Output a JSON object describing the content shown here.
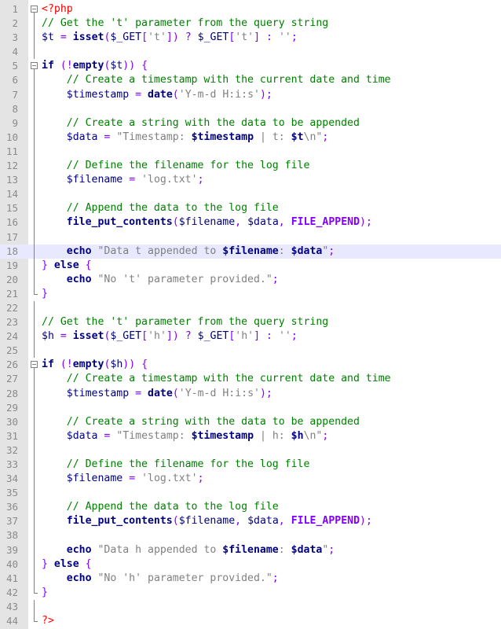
{
  "editor": {
    "current_line": 18,
    "lines": [
      {
        "num": "1",
        "fold": "box",
        "tokens": [
          {
            "t": "<?php",
            "c": "php"
          }
        ]
      },
      {
        "num": "2",
        "fold": "line",
        "tokens": [
          {
            "t": "// Get the 't' parameter from the query string",
            "c": "cm"
          }
        ]
      },
      {
        "num": "3",
        "fold": "line",
        "tokens": [
          {
            "t": "$t",
            "c": "var"
          },
          {
            "t": " ",
            "c": "plain"
          },
          {
            "t": "=",
            "c": "op"
          },
          {
            "t": " ",
            "c": "plain"
          },
          {
            "t": "isset",
            "c": "kw"
          },
          {
            "t": "(",
            "c": "op"
          },
          {
            "t": "$_GET",
            "c": "var"
          },
          {
            "t": "[",
            "c": "op"
          },
          {
            "t": "'t'",
            "c": "str"
          },
          {
            "t": "])",
            "c": "op"
          },
          {
            "t": " ",
            "c": "plain"
          },
          {
            "t": "?",
            "c": "op"
          },
          {
            "t": " ",
            "c": "plain"
          },
          {
            "t": "$_GET",
            "c": "var"
          },
          {
            "t": "[",
            "c": "op"
          },
          {
            "t": "'t'",
            "c": "str"
          },
          {
            "t": "]",
            "c": "op"
          },
          {
            "t": " ",
            "c": "plain"
          },
          {
            "t": ":",
            "c": "op"
          },
          {
            "t": " ",
            "c": "plain"
          },
          {
            "t": "''",
            "c": "str"
          },
          {
            "t": ";",
            "c": "op"
          }
        ]
      },
      {
        "num": "4",
        "fold": "line",
        "tokens": []
      },
      {
        "num": "5",
        "fold": "box",
        "tokens": [
          {
            "t": "if",
            "c": "kw"
          },
          {
            "t": " ",
            "c": "plain"
          },
          {
            "t": "(!",
            "c": "op"
          },
          {
            "t": "empty",
            "c": "kw"
          },
          {
            "t": "(",
            "c": "op"
          },
          {
            "t": "$t",
            "c": "var"
          },
          {
            "t": "))",
            "c": "op"
          },
          {
            "t": " ",
            "c": "plain"
          },
          {
            "t": "{",
            "c": "op"
          }
        ]
      },
      {
        "num": "6",
        "fold": "line",
        "tokens": [
          {
            "t": "    ",
            "c": "plain"
          },
          {
            "t": "// Create a timestamp with the current date and time",
            "c": "cm"
          }
        ]
      },
      {
        "num": "7",
        "fold": "line",
        "tokens": [
          {
            "t": "    ",
            "c": "plain"
          },
          {
            "t": "$timestamp",
            "c": "var"
          },
          {
            "t": " ",
            "c": "plain"
          },
          {
            "t": "=",
            "c": "op"
          },
          {
            "t": " ",
            "c": "plain"
          },
          {
            "t": "date",
            "c": "kw"
          },
          {
            "t": "(",
            "c": "op"
          },
          {
            "t": "'Y-m-d H:i:s'",
            "c": "str"
          },
          {
            "t": ");",
            "c": "op"
          }
        ]
      },
      {
        "num": "8",
        "fold": "line",
        "tokens": []
      },
      {
        "num": "9",
        "fold": "line",
        "tokens": [
          {
            "t": "    ",
            "c": "plain"
          },
          {
            "t": "// Create a string with the data to be appended",
            "c": "cm"
          }
        ]
      },
      {
        "num": "10",
        "fold": "line",
        "tokens": [
          {
            "t": "    ",
            "c": "plain"
          },
          {
            "t": "$data",
            "c": "var"
          },
          {
            "t": " ",
            "c": "plain"
          },
          {
            "t": "=",
            "c": "op"
          },
          {
            "t": " ",
            "c": "plain"
          },
          {
            "t": "\"Timestamp: ",
            "c": "str"
          },
          {
            "t": "$timestamp",
            "c": "kw"
          },
          {
            "t": " | t: ",
            "c": "str"
          },
          {
            "t": "$t",
            "c": "kw"
          },
          {
            "t": "\\n\"",
            "c": "str"
          },
          {
            "t": ";",
            "c": "op"
          }
        ]
      },
      {
        "num": "11",
        "fold": "line",
        "tokens": []
      },
      {
        "num": "12",
        "fold": "line",
        "tokens": [
          {
            "t": "    ",
            "c": "plain"
          },
          {
            "t": "// Define the filename for the log file",
            "c": "cm"
          }
        ]
      },
      {
        "num": "13",
        "fold": "line",
        "tokens": [
          {
            "t": "    ",
            "c": "plain"
          },
          {
            "t": "$filename",
            "c": "var"
          },
          {
            "t": " ",
            "c": "plain"
          },
          {
            "t": "=",
            "c": "op"
          },
          {
            "t": " ",
            "c": "plain"
          },
          {
            "t": "'log.txt'",
            "c": "str"
          },
          {
            "t": ";",
            "c": "op"
          }
        ]
      },
      {
        "num": "14",
        "fold": "line",
        "tokens": []
      },
      {
        "num": "15",
        "fold": "line",
        "tokens": [
          {
            "t": "    ",
            "c": "plain"
          },
          {
            "t": "// Append the data to the log file",
            "c": "cm"
          }
        ]
      },
      {
        "num": "16",
        "fold": "line",
        "tokens": [
          {
            "t": "    ",
            "c": "plain"
          },
          {
            "t": "file_put_contents",
            "c": "kw"
          },
          {
            "t": "(",
            "c": "op"
          },
          {
            "t": "$filename",
            "c": "var"
          },
          {
            "t": ",",
            "c": "op"
          },
          {
            "t": " ",
            "c": "plain"
          },
          {
            "t": "$data",
            "c": "var"
          },
          {
            "t": ",",
            "c": "op"
          },
          {
            "t": " ",
            "c": "plain"
          },
          {
            "t": "FILE_APPEND",
            "c": "cst"
          },
          {
            "t": ");",
            "c": "op"
          }
        ]
      },
      {
        "num": "17",
        "fold": "line",
        "tokens": []
      },
      {
        "num": "18",
        "fold": "line",
        "tokens": [
          {
            "t": "    ",
            "c": "plain"
          },
          {
            "t": "echo",
            "c": "kw"
          },
          {
            "t": " ",
            "c": "plain"
          },
          {
            "t": "\"Data t appended to ",
            "c": "str"
          },
          {
            "t": "$filename",
            "c": "kw"
          },
          {
            "t": ": ",
            "c": "str"
          },
          {
            "t": "$data",
            "c": "kw"
          },
          {
            "t": "\"",
            "c": "str"
          },
          {
            "t": ";",
            "c": "op"
          }
        ]
      },
      {
        "num": "19",
        "fold": "line",
        "tokens": [
          {
            "t": "}",
            "c": "op"
          },
          {
            "t": " ",
            "c": "plain"
          },
          {
            "t": "else",
            "c": "kw"
          },
          {
            "t": " ",
            "c": "plain"
          },
          {
            "t": "{",
            "c": "op"
          }
        ]
      },
      {
        "num": "20",
        "fold": "line",
        "tokens": [
          {
            "t": "    ",
            "c": "plain"
          },
          {
            "t": "echo",
            "c": "kw"
          },
          {
            "t": " ",
            "c": "plain"
          },
          {
            "t": "\"No 't' parameter provided.\"",
            "c": "str"
          },
          {
            "t": ";",
            "c": "op"
          }
        ]
      },
      {
        "num": "21",
        "fold": "end",
        "tokens": [
          {
            "t": "}",
            "c": "op"
          }
        ]
      },
      {
        "num": "22",
        "fold": "line",
        "tokens": []
      },
      {
        "num": "23",
        "fold": "line",
        "tokens": [
          {
            "t": "// Get the 't' parameter from the query string",
            "c": "cm"
          }
        ]
      },
      {
        "num": "24",
        "fold": "line",
        "tokens": [
          {
            "t": "$h",
            "c": "var"
          },
          {
            "t": " ",
            "c": "plain"
          },
          {
            "t": "=",
            "c": "op"
          },
          {
            "t": " ",
            "c": "plain"
          },
          {
            "t": "isset",
            "c": "kw"
          },
          {
            "t": "(",
            "c": "op"
          },
          {
            "t": "$_GET",
            "c": "var"
          },
          {
            "t": "[",
            "c": "op"
          },
          {
            "t": "'h'",
            "c": "str"
          },
          {
            "t": "])",
            "c": "op"
          },
          {
            "t": " ",
            "c": "plain"
          },
          {
            "t": "?",
            "c": "op"
          },
          {
            "t": " ",
            "c": "plain"
          },
          {
            "t": "$_GET",
            "c": "var"
          },
          {
            "t": "[",
            "c": "op"
          },
          {
            "t": "'h'",
            "c": "str"
          },
          {
            "t": "]",
            "c": "op"
          },
          {
            "t": " ",
            "c": "plain"
          },
          {
            "t": ":",
            "c": "op"
          },
          {
            "t": " ",
            "c": "plain"
          },
          {
            "t": "''",
            "c": "str"
          },
          {
            "t": ";",
            "c": "op"
          }
        ]
      },
      {
        "num": "25",
        "fold": "line",
        "tokens": []
      },
      {
        "num": "26",
        "fold": "box",
        "tokens": [
          {
            "t": "if",
            "c": "kw"
          },
          {
            "t": " ",
            "c": "plain"
          },
          {
            "t": "(!",
            "c": "op"
          },
          {
            "t": "empty",
            "c": "kw"
          },
          {
            "t": "(",
            "c": "op"
          },
          {
            "t": "$h",
            "c": "var"
          },
          {
            "t": "))",
            "c": "op"
          },
          {
            "t": " ",
            "c": "plain"
          },
          {
            "t": "{",
            "c": "op"
          }
        ]
      },
      {
        "num": "27",
        "fold": "line",
        "tokens": [
          {
            "t": "    ",
            "c": "plain"
          },
          {
            "t": "// Create a timestamp with the current date and time",
            "c": "cm"
          }
        ]
      },
      {
        "num": "28",
        "fold": "line",
        "tokens": [
          {
            "t": "    ",
            "c": "plain"
          },
          {
            "t": "$timestamp",
            "c": "var"
          },
          {
            "t": " ",
            "c": "plain"
          },
          {
            "t": "=",
            "c": "op"
          },
          {
            "t": " ",
            "c": "plain"
          },
          {
            "t": "date",
            "c": "kw"
          },
          {
            "t": "(",
            "c": "op"
          },
          {
            "t": "'Y-m-d H:i:s'",
            "c": "str"
          },
          {
            "t": ");",
            "c": "op"
          }
        ]
      },
      {
        "num": "29",
        "fold": "line",
        "tokens": []
      },
      {
        "num": "30",
        "fold": "line",
        "tokens": [
          {
            "t": "    ",
            "c": "plain"
          },
          {
            "t": "// Create a string with the data to be appended",
            "c": "cm"
          }
        ]
      },
      {
        "num": "31",
        "fold": "line",
        "tokens": [
          {
            "t": "    ",
            "c": "plain"
          },
          {
            "t": "$data",
            "c": "var"
          },
          {
            "t": " ",
            "c": "plain"
          },
          {
            "t": "=",
            "c": "op"
          },
          {
            "t": " ",
            "c": "plain"
          },
          {
            "t": "\"Timestamp: ",
            "c": "str"
          },
          {
            "t": "$timestamp",
            "c": "kw"
          },
          {
            "t": " | h: ",
            "c": "str"
          },
          {
            "t": "$h",
            "c": "kw"
          },
          {
            "t": "\\n\"",
            "c": "str"
          },
          {
            "t": ";",
            "c": "op"
          }
        ]
      },
      {
        "num": "32",
        "fold": "line",
        "tokens": []
      },
      {
        "num": "33",
        "fold": "line",
        "tokens": [
          {
            "t": "    ",
            "c": "plain"
          },
          {
            "t": "// Define the filename for the log file",
            "c": "cm"
          }
        ]
      },
      {
        "num": "34",
        "fold": "line",
        "tokens": [
          {
            "t": "    ",
            "c": "plain"
          },
          {
            "t": "$filename",
            "c": "var"
          },
          {
            "t": " ",
            "c": "plain"
          },
          {
            "t": "=",
            "c": "op"
          },
          {
            "t": " ",
            "c": "plain"
          },
          {
            "t": "'log.txt'",
            "c": "str"
          },
          {
            "t": ";",
            "c": "op"
          }
        ]
      },
      {
        "num": "35",
        "fold": "line",
        "tokens": []
      },
      {
        "num": "36",
        "fold": "line",
        "tokens": [
          {
            "t": "    ",
            "c": "plain"
          },
          {
            "t": "// Append the data to the log file",
            "c": "cm"
          }
        ]
      },
      {
        "num": "37",
        "fold": "line",
        "tokens": [
          {
            "t": "    ",
            "c": "plain"
          },
          {
            "t": "file_put_contents",
            "c": "kw"
          },
          {
            "t": "(",
            "c": "op"
          },
          {
            "t": "$filename",
            "c": "var"
          },
          {
            "t": ",",
            "c": "op"
          },
          {
            "t": " ",
            "c": "plain"
          },
          {
            "t": "$data",
            "c": "var"
          },
          {
            "t": ",",
            "c": "op"
          },
          {
            "t": " ",
            "c": "plain"
          },
          {
            "t": "FILE_APPEND",
            "c": "cst"
          },
          {
            "t": ");",
            "c": "op"
          }
        ]
      },
      {
        "num": "38",
        "fold": "line",
        "tokens": []
      },
      {
        "num": "39",
        "fold": "line",
        "tokens": [
          {
            "t": "    ",
            "c": "plain"
          },
          {
            "t": "echo",
            "c": "kw"
          },
          {
            "t": " ",
            "c": "plain"
          },
          {
            "t": "\"Data h appended to ",
            "c": "str"
          },
          {
            "t": "$filename",
            "c": "kw"
          },
          {
            "t": ": ",
            "c": "str"
          },
          {
            "t": "$data",
            "c": "kw"
          },
          {
            "t": "\"",
            "c": "str"
          },
          {
            "t": ";",
            "c": "op"
          }
        ]
      },
      {
        "num": "40",
        "fold": "line",
        "tokens": [
          {
            "t": "}",
            "c": "op"
          },
          {
            "t": " ",
            "c": "plain"
          },
          {
            "t": "else",
            "c": "kw"
          },
          {
            "t": " ",
            "c": "plain"
          },
          {
            "t": "{",
            "c": "op"
          }
        ]
      },
      {
        "num": "41",
        "fold": "line",
        "tokens": [
          {
            "t": "    ",
            "c": "plain"
          },
          {
            "t": "echo",
            "c": "kw"
          },
          {
            "t": " ",
            "c": "plain"
          },
          {
            "t": "\"No 'h' parameter provided.\"",
            "c": "str"
          },
          {
            "t": ";",
            "c": "op"
          }
        ]
      },
      {
        "num": "42",
        "fold": "end",
        "tokens": [
          {
            "t": "}",
            "c": "op"
          }
        ]
      },
      {
        "num": "43",
        "fold": "line",
        "tokens": []
      },
      {
        "num": "44",
        "fold": "end",
        "tokens": [
          {
            "t": "?>",
            "c": "php"
          }
        ]
      }
    ]
  },
  "colors": {
    "gutter_bg": "#e4e4e4",
    "current_line_bg": "#e8e8ff",
    "comment": "#008000",
    "keyword": "#000080",
    "string": "#808080",
    "operator": "#8000ff",
    "php_tag": "#ff0000"
  }
}
